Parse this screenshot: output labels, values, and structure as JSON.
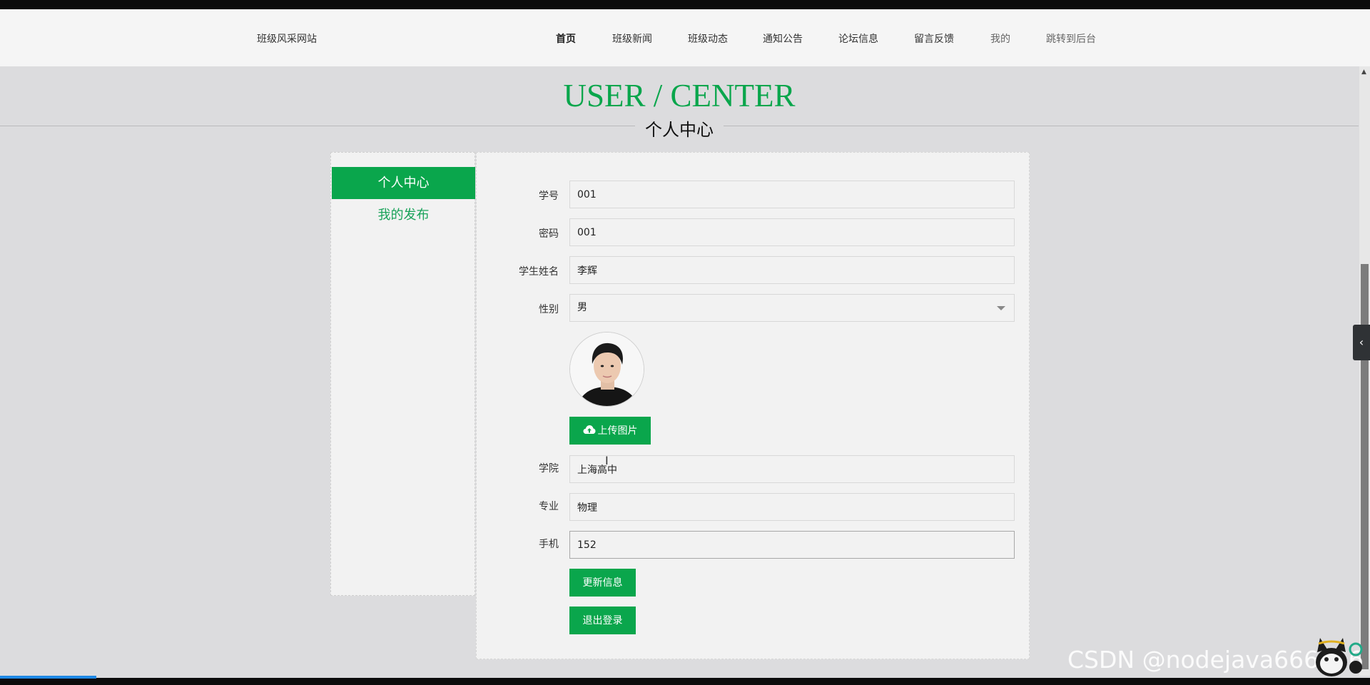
{
  "nav": {
    "site_title": "班级风采网站",
    "items": [
      {
        "label": "首页"
      },
      {
        "label": "班级新闻"
      },
      {
        "label": "班级动态"
      },
      {
        "label": "通知公告"
      },
      {
        "label": "论坛信息"
      },
      {
        "label": "留言反馈"
      },
      {
        "label": "我的"
      },
      {
        "label": "跳转到后台"
      }
    ]
  },
  "heading": {
    "en": "USER / CENTER",
    "cn": "个人中心"
  },
  "sidebar": {
    "items": [
      {
        "label": "个人中心"
      },
      {
        "label": "我的发布"
      }
    ]
  },
  "form": {
    "student_id": {
      "label": "学号",
      "value": "001"
    },
    "password": {
      "label": "密码",
      "value": "001"
    },
    "name": {
      "label": "学生姓名",
      "value": "李辉"
    },
    "gender": {
      "label": "性别",
      "value": "男"
    },
    "upload_label": "上传图片",
    "college": {
      "label": "学院",
      "value": "上海高中"
    },
    "major": {
      "label": "专业",
      "value": "物理"
    },
    "phone": {
      "label": "手机",
      "value": "152"
    },
    "update_label": "更新信息",
    "logout_label": "退出登录"
  },
  "overlay": {
    "watermark": "CSDN @nodejava666666"
  },
  "colors": {
    "accent": "#0aa64c",
    "background": "#dcdcde",
    "panel": "#f2f2f2"
  },
  "icons": [
    "cloud-upload-icon",
    "chevron-left-icon",
    "caret-down-icon",
    "text-cursor-icon"
  ]
}
